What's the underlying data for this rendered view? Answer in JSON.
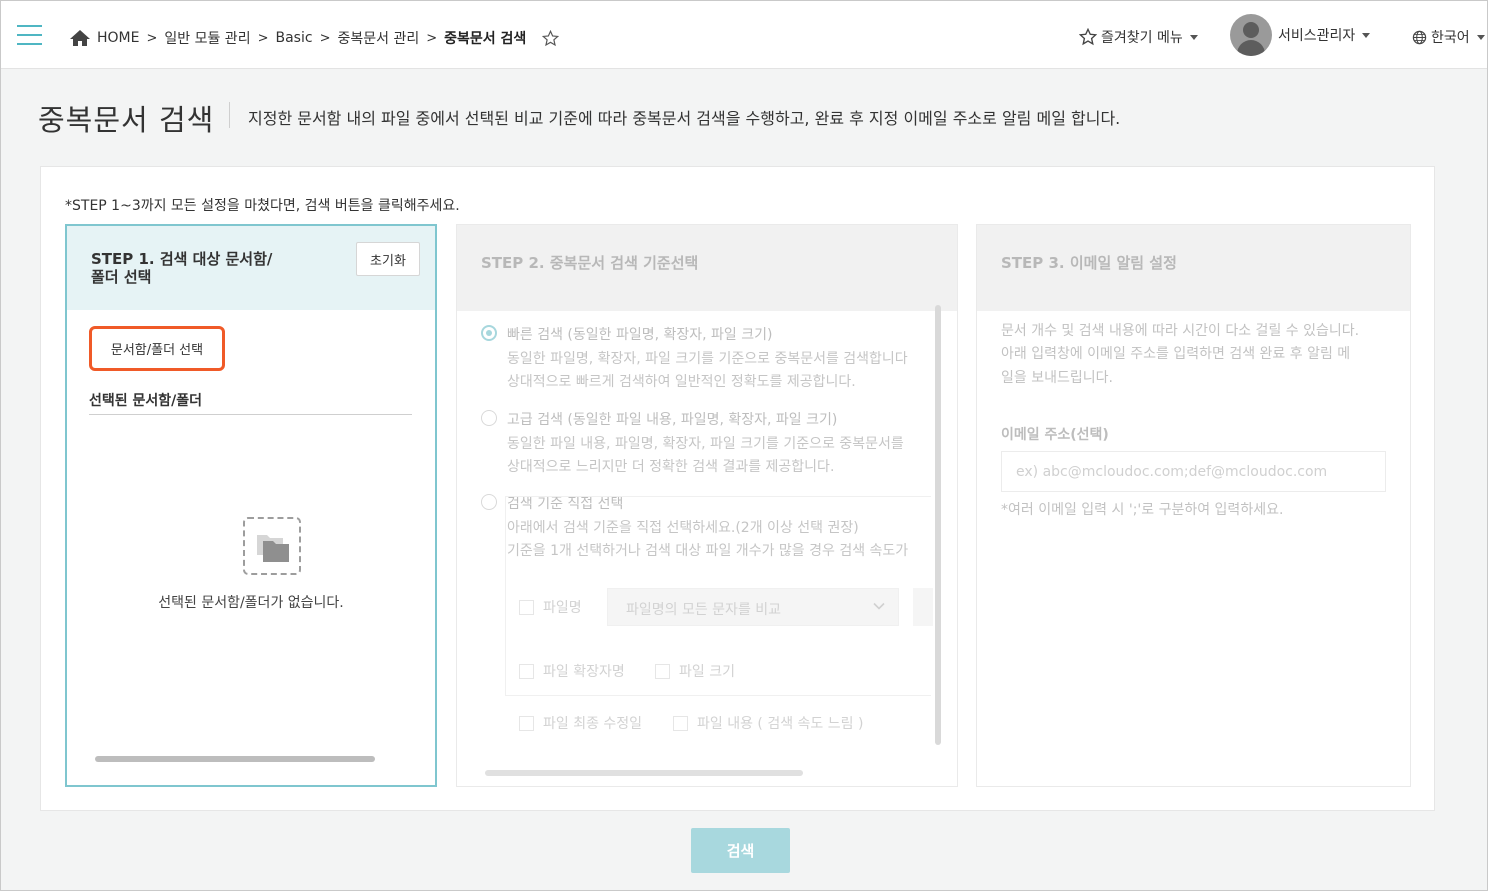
{
  "header": {
    "breadcrumb": {
      "home": "HOME",
      "separator": ">",
      "items": [
        "일반 모듈 관리",
        "Basic",
        "중복문서 관리"
      ],
      "current": "중복문서 검색"
    },
    "favorites_menu": "즐겨찾기 메뉴",
    "user_name": "서비스관리자",
    "language": "한국어",
    "accent_color": "#4fb6c3"
  },
  "page": {
    "title": "중복문서 검색",
    "description": "지정한 문서함 내의 파일 중에서 선택된 비교 기준에 따라 중복문서 검색을 수행하고, 완료 후 지정 이메일 주소로 알림 메일 합니다.",
    "notice": "*STEP 1~3까지 모든 설정을 마쳤다면, 검색 버튼을 클릭해주세요."
  },
  "step1": {
    "title": "STEP 1. 검색 대상 문서함/\n폴더 선택",
    "reset_label": "초기화",
    "select_button": "문서함/폴더 선택",
    "selected_label": "선택된 문서함/폴더",
    "empty_message": "선택된 문서함/폴더가 없습니다.",
    "highlight_color": "#f05a28"
  },
  "step2": {
    "title": "STEP 2. 중복문서 검색 기준선택",
    "options": [
      {
        "title": "빠른 검색 (동일한 파일명, 확장자, 파일 크기)",
        "desc1": "동일한 파일명, 확장자, 파일 크기를 기준으로 중복문서를 검색합니다",
        "desc2": "상대적으로 빠르게 검색하여 일반적인 정확도를 제공합니다.",
        "checked": true
      },
      {
        "title": "고급 검색 (동일한 파일 내용, 파일명, 확장자, 파일 크기)",
        "desc1": "동일한 파일 내용, 파일명, 확장자, 파일 크기를 기준으로 중복문서를",
        "desc2": "상대적으로 느리지만 더 정확한 검색 결과를 제공합니다.",
        "checked": false
      },
      {
        "title": "검색 기준 직접 선택",
        "desc1": "아래에서 검색 기준을 직접 선택하세요.(2개 이상 선택 권장)",
        "desc2": "기준을 1개 선택하거나 검색 대상 파일 개수가 많을 경우 검색 속도가",
        "checked": false
      }
    ],
    "criteria": {
      "filename": "파일명",
      "filename_compare": "파일명의 모든 문자를 비교",
      "extension": "파일 확장자명",
      "size": "파일 크기",
      "modified": "파일 최종 수정일",
      "content": "파일 내용 ( 검색 속도 느림 )"
    }
  },
  "step3": {
    "title": "STEP 3. 이메일 알림 설정",
    "info_lines": [
      "문서 개수 및 검색 내용에 따라 시간이 다소 걸릴 수 있습니다.",
      "아래 입력창에 이메일 주소를 입력하면 검색 완료 후 알림 메",
      "일을 보내드립니다."
    ],
    "email_label": "이메일 주소(선택)",
    "email_value": "",
    "email_placeholder": "ex) abc@mcloudoc.com;def@mcloudoc.com",
    "email_hint": "*여러 이메일 입력 시 ';'로 구분하여 입력하세요."
  },
  "actions": {
    "search_label": "검색"
  }
}
